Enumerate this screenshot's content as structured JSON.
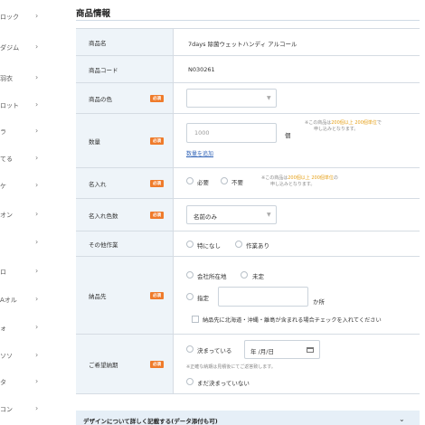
{
  "sidebar": {
    "items": [
      {
        "label": "ロック",
        "chev": "›"
      },
      {
        "label": "ダジム",
        "chev": "›"
      },
      {
        "label": "羽衣",
        "chev": "›"
      },
      {
        "label": "ロット",
        "chev": "›"
      },
      {
        "label": "ラ",
        "chev": "›"
      },
      {
        "label": "てる",
        "chev": "›"
      },
      {
        "label": "ケ",
        "chev": "›"
      },
      {
        "label": "オン",
        "chev": "›"
      },
      {
        "label": "",
        "chev": "›"
      },
      {
        "label": "ロ",
        "chev": "›"
      },
      {
        "label": "Aオル",
        "chev": "›"
      },
      {
        "label": "ォ",
        "chev": "›"
      },
      {
        "label": "ソソ",
        "chev": "›"
      },
      {
        "label": "タ",
        "chev": "›"
      },
      {
        "label": "コン",
        "chev": "›"
      }
    ]
  },
  "section_title": "商品情報",
  "rows": {
    "name": {
      "label": "商品名",
      "value": "7days 除菌ウェットハンディ アルコール"
    },
    "code": {
      "label": "商品コード",
      "value": "N030261"
    },
    "color": {
      "label": "商品の色",
      "required": "必須",
      "arrow": "▼"
    },
    "qty": {
      "label": "数量",
      "required": "必須",
      "placeholder": "1000",
      "unit": "個",
      "note_prefix": "※この商品は",
      "note_em": "200個以上 200個単位",
      "note_suffix": "で",
      "note_line2": "申し込みとなります。",
      "add_link": "数量を追加"
    },
    "print": {
      "label": "名入れ",
      "required": "必須",
      "opt_yes": "必要",
      "opt_no": "不要",
      "note_prefix": "※この商品は",
      "note_em": "200個以上 200個単位",
      "note_suffix": "の",
      "note_line2": "申し込みとなります。"
    },
    "print_colors": {
      "label": "名入れ色数",
      "required": "必須",
      "value": "名前のみ",
      "arrow": "▼"
    },
    "other": {
      "label": "その他作業",
      "opt_none": "特になし",
      "opt_yes": "作業あり"
    },
    "delivery": {
      "label": "納品先",
      "required": "必須",
      "opt_office": "会社所在地",
      "opt_undecided": "未定",
      "opt_specify": "指定",
      "unit": "か所",
      "check_label": "納品先に北海道・沖縄・離島が含まれる場合チェックを入れてください"
    },
    "date": {
      "label": "ご希望納期",
      "required": "必須",
      "opt_decided": "決まっている",
      "date_placeholder": "年 /月/日",
      "note": "※正確な納期は見積後にてご返答致します。",
      "opt_not_decided": "まだ決まっていない"
    }
  },
  "accordion": {
    "label": "デザインについて詳しく記載する(データ添付も可)",
    "chev": "⌄"
  },
  "colors": {
    "accent": "#ef7b2b",
    "label_bg": "#eef4f9",
    "link": "#3567b8",
    "note_highlight": "#e6a119"
  }
}
